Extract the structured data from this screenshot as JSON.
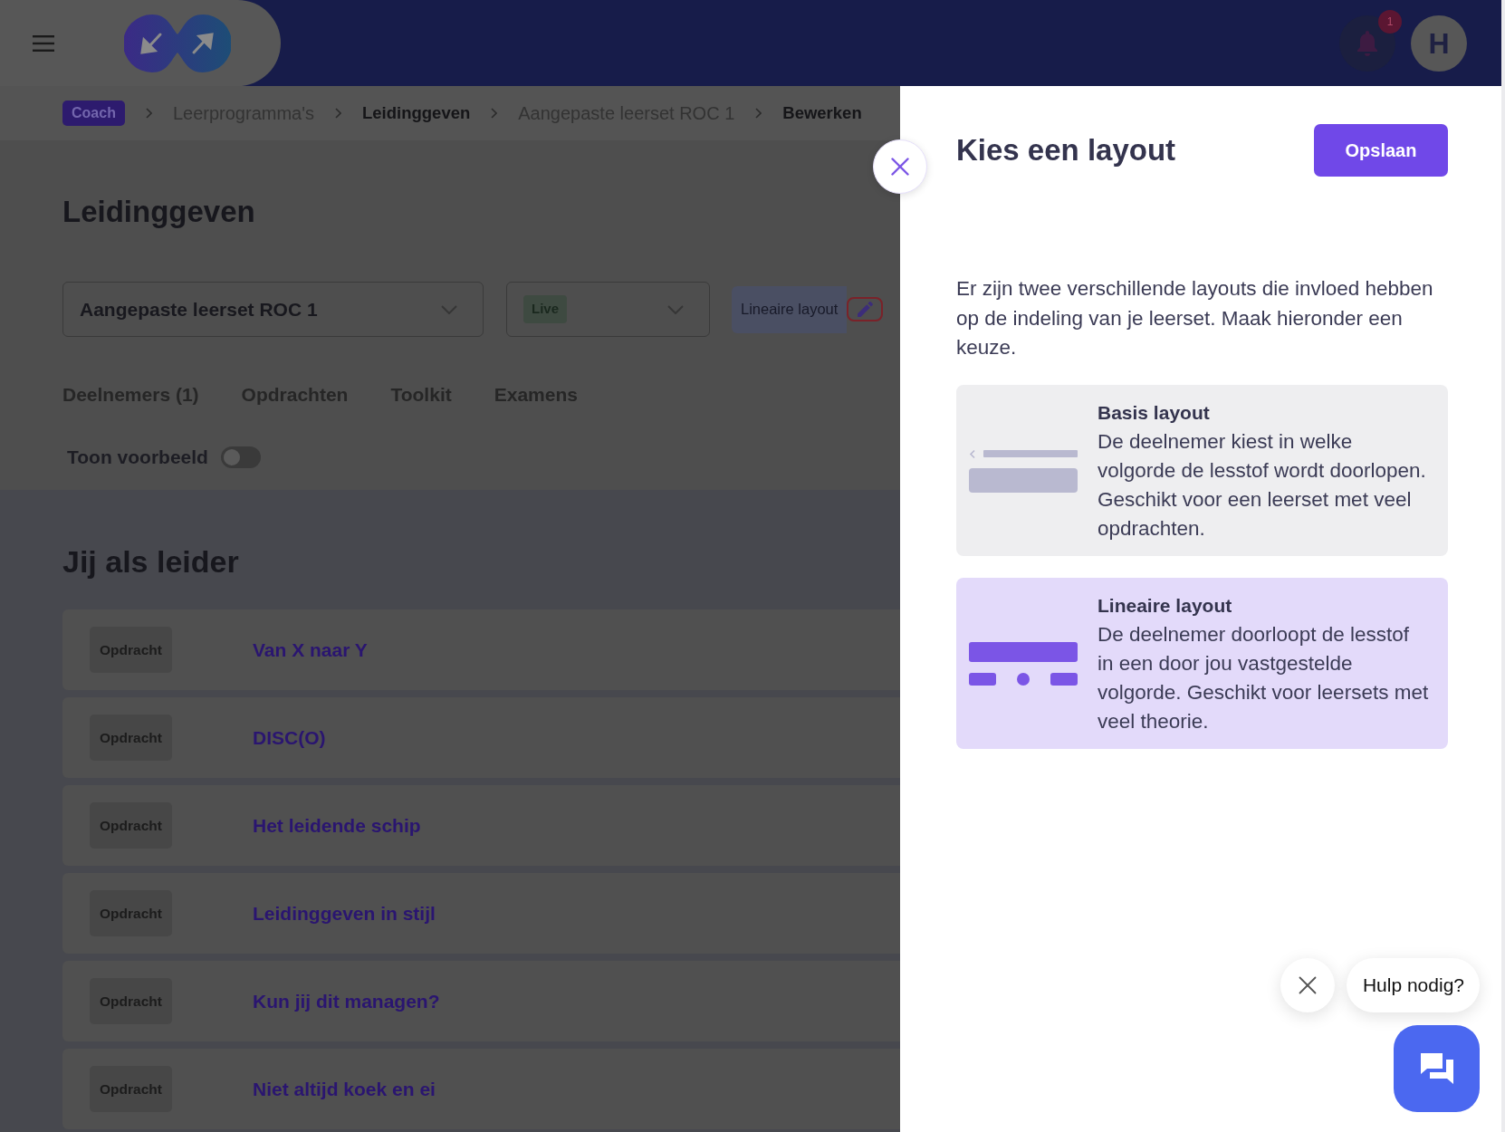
{
  "header": {
    "notification_count": "1",
    "avatar_initial": "H"
  },
  "breadcrumb": [
    {
      "label": "Coach",
      "kind": "badge"
    },
    {
      "label": "Leerprogramma's",
      "kind": "muted"
    },
    {
      "label": "Leidinggeven",
      "kind": "strong"
    },
    {
      "label": "Aangepaste leerset ROC 1",
      "kind": "muted"
    },
    {
      "label": "Bewerken",
      "kind": "strong"
    }
  ],
  "page": {
    "title": "Leidinggeven",
    "set_select": {
      "value": "Aangepaste leerset ROC 1"
    },
    "status_select": {
      "value": "Live"
    },
    "layout_label": "Lineaire layout",
    "tabs": [
      {
        "label": "Deelnemers (1)",
        "selected": false
      },
      {
        "label": "Opdrachten",
        "selected": false
      },
      {
        "label": "Toolkit",
        "selected": false
      },
      {
        "label": "Examens",
        "selected": false
      }
    ],
    "preview_toggle": {
      "label": "Toon voorbeeld",
      "on": false
    }
  },
  "section": {
    "title": "Jij als leider",
    "items": [
      {
        "type": "Opdracht",
        "title": "Van X naar Y"
      },
      {
        "type": "Opdracht",
        "title": "DISC(O)"
      },
      {
        "type": "Opdracht",
        "title": "Het leidende schip"
      },
      {
        "type": "Opdracht",
        "title": "Leidinggeven in stijl"
      },
      {
        "type": "Opdracht",
        "title": "Kun jij dit managen?"
      },
      {
        "type": "Opdracht",
        "title": "Niet altijd koek en ei"
      }
    ]
  },
  "drawer": {
    "title": "Kies een layout",
    "save_label": "Opslaan",
    "intro": "Er zijn twee verschillende layouts die invloed hebben op de indeling van je leerset. Maak hieronder een keuze.",
    "options": [
      {
        "kind": "basis",
        "title": "Basis layout",
        "description": "De deelnemer kiest in welke volgorde de lesstof wordt doorlopen. Geschikt voor een leerset met veel opdrachten.",
        "selected": false
      },
      {
        "kind": "linear",
        "title": "Lineaire layout",
        "description": "De deelnemer doorloopt de lesstof in een door jou vastgestelde volgorde. Geschikt voor leersets met veel theorie.",
        "selected": true
      }
    ]
  },
  "help": {
    "label": "Hulp nodig?"
  }
}
